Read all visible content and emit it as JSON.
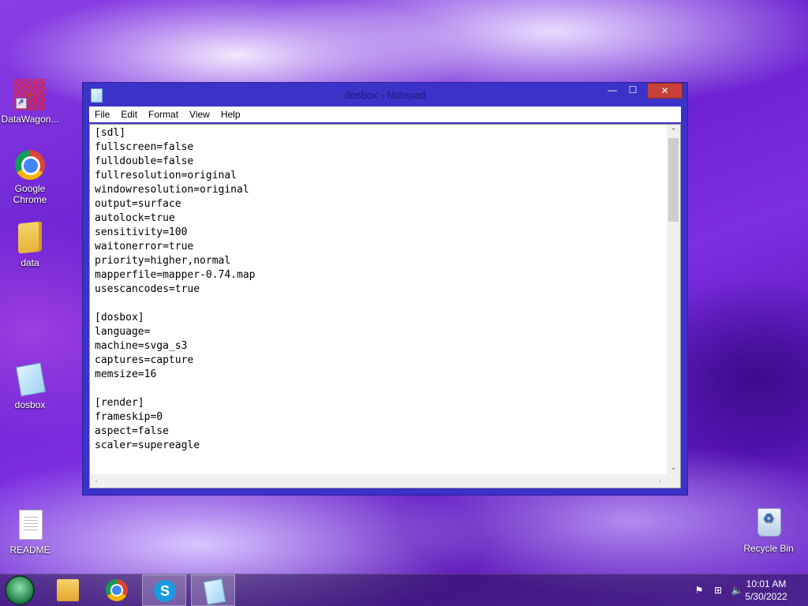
{
  "desktop": {
    "icons": [
      {
        "label": "DataWagon...",
        "icon": "datawagon-shortcut-icon"
      },
      {
        "label": "Google Chrome",
        "icon": "chrome-icon"
      },
      {
        "label": "data",
        "icon": "folder-icon"
      },
      {
        "label": "dosbox",
        "icon": "notepad-file-icon"
      },
      {
        "label": "README",
        "icon": "text-document-icon"
      },
      {
        "label": "Recycle Bin",
        "icon": "recycle-bin-icon"
      }
    ]
  },
  "window": {
    "title": "dosbox - Notepad",
    "controls": {
      "minimize": "—",
      "maximize": "☐",
      "close": "✕"
    },
    "menu": [
      "File",
      "Edit",
      "Format",
      "View",
      "Help"
    ],
    "lines": [
      "[sdl]",
      "fullscreen=false",
      "fulldouble=false",
      "fullresolution=original",
      "windowresolution=original",
      "output=surface",
      "autolock=true",
      "sensitivity=100",
      "waitonerror=true",
      "priority=higher,normal",
      "mapperfile=mapper-0.74.map",
      "usescancodes=true",
      "",
      "[dosbox]",
      "language=",
      "machine=svga_s3",
      "captures=capture",
      "memsize=16",
      "",
      "[render]",
      "frameskip=0",
      "aspect=false",
      "scaler=supereagle"
    ],
    "scroll_up": "⌃",
    "scroll_down": "⌄",
    "scroll_left": "‹",
    "scroll_right": "›"
  },
  "taskbar": {
    "items": [
      "start-button",
      "file-explorer",
      "google-chrome",
      "skype",
      "notepad"
    ],
    "active": "notepad",
    "tray": {
      "flag": "⚑",
      "network": "⊞",
      "volume": "🔈"
    },
    "time": "10:01 AM",
    "date": "5/30/2022"
  },
  "colors": {
    "window_frame": "#3b32c8",
    "close_button": "#c7403a",
    "taskbar": "#28144f"
  }
}
